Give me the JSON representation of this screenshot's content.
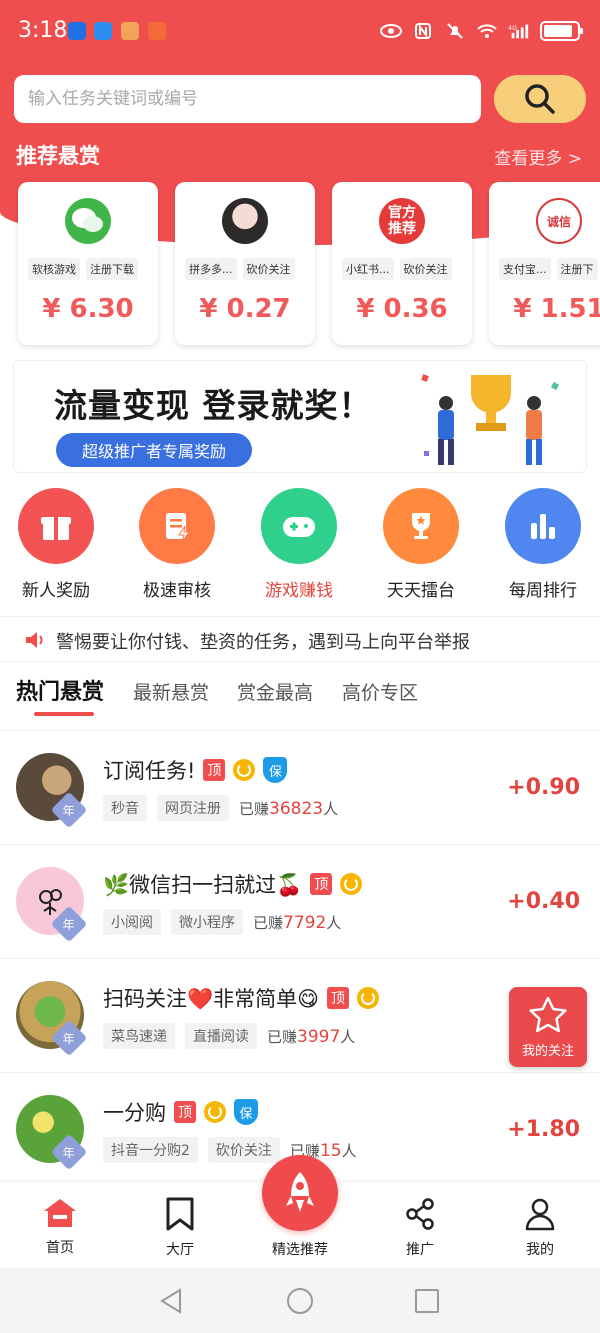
{
  "status_bar": {
    "time": "3:18",
    "network": "4G"
  },
  "search": {
    "placeholder": "输入任务关键词或编号"
  },
  "recommend": {
    "title": "推荐悬赏",
    "more": "查看更多 >",
    "cards": [
      {
        "tags": [
          "软核游戏",
          "注册下载"
        ],
        "price": "¥ 6.30",
        "avatar": "wechat-avatar"
      },
      {
        "tags": [
          "拼多多...",
          "砍价关注"
        ],
        "price": "¥ 0.27",
        "avatar": "girl-avatar"
      },
      {
        "tags": [
          "小红书...",
          "砍价关注"
        ],
        "price": "¥ 0.36",
        "avatar": "official-recommend-avatar",
        "avatar_text": "官方推荐"
      },
      {
        "tags": [
          "支付宝...",
          "注册下"
        ],
        "price": "¥ 1.51",
        "avatar": "seal-avatar",
        "avatar_text": "诚信"
      }
    ]
  },
  "banner": {
    "title": "流量变现  登录就奖！",
    "button": "超级推广者专属奖励"
  },
  "quick_actions": [
    {
      "label": "新人奖励",
      "color": "#f45353",
      "icon": "gift-icon"
    },
    {
      "label": "极速审核",
      "color": "#ff7a45",
      "icon": "document-flash-icon"
    },
    {
      "label": "游戏赚钱",
      "color": "#2fd08b",
      "icon": "gamepad-icon",
      "active": true
    },
    {
      "label": "天天擂台",
      "color": "#ff8a3d",
      "icon": "trophy-icon"
    },
    {
      "label": "每周排行",
      "color": "#4f86f0",
      "icon": "bar-chart-icon"
    }
  ],
  "notice": {
    "text": "警惕要让你付钱、垫资的任务，遇到马上向平台举报"
  },
  "tabs": [
    "热门悬赏",
    "最新悬赏",
    "赏金最高",
    "高价专区"
  ],
  "tasks": [
    {
      "title": "订阅任务!",
      "badges": [
        "顶",
        "circle",
        "保"
      ],
      "chips": [
        "秒音",
        "网页注册"
      ],
      "earned_prefix": "已赚",
      "earned_num": "36823",
      "earned_suffix": "人",
      "reward": "+0.90",
      "year": "年"
    },
    {
      "title": "🌿微信扫一扫就过🍒",
      "badges": [
        "顶",
        "circle"
      ],
      "chips": [
        "小阅阅",
        "微小程序"
      ],
      "earned_prefix": "已赚",
      "earned_num": "7792",
      "earned_suffix": "人",
      "reward": "+0.40",
      "year": "年"
    },
    {
      "title": "扫码关注❤️非常简单😋",
      "badges": [
        "顶",
        "circle"
      ],
      "chips": [
        "菜鸟速递",
        "直播阅读"
      ],
      "earned_prefix": "已赚",
      "earned_num": "3997",
      "earned_suffix": "人",
      "reward": "",
      "year": "年"
    },
    {
      "title": "一分购",
      "badges": [
        "顶",
        "circle",
        "保"
      ],
      "chips": [
        "抖音一分购2",
        "砍价关注"
      ],
      "earned_prefix": "已赚",
      "earned_num": "15",
      "earned_suffix": "人",
      "reward": "+1.80",
      "year": "年"
    }
  ],
  "favorite": {
    "label": "我的关注"
  },
  "bottom_nav": [
    {
      "label": "首页",
      "icon": "home-icon",
      "active": true
    },
    {
      "label": "大厅",
      "icon": "bookmark-icon"
    },
    {
      "label": "精选推荐",
      "icon": "rocket-icon"
    },
    {
      "label": "推广",
      "icon": "share-icon"
    },
    {
      "label": "我的",
      "icon": "person-icon"
    }
  ],
  "colors": {
    "primary": "#f04d4f",
    "search_btn": "#f7cf7a",
    "price": "#f05a5a"
  }
}
